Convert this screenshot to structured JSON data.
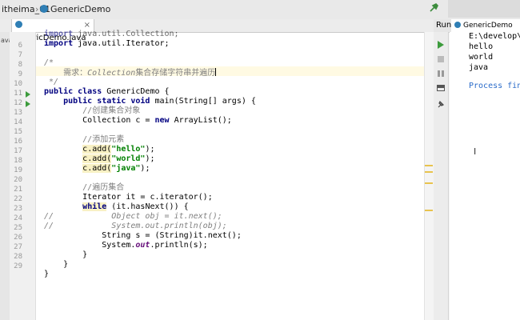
{
  "breadcrumb": {
    "project": "itheima_01",
    "file": "GenericDemo"
  },
  "editor_tab": {
    "label": "GenericDemo.java",
    "close": "×"
  },
  "left_strip": {
    "label": "ava"
  },
  "run_panel": {
    "run_label": "Run:",
    "tab_label": "GenericDemo",
    "console": [
      "E:\\develop\\",
      "hello",
      "world",
      "java",
      "",
      "Process fin"
    ]
  },
  "line_numbers": [
    "",
    "6",
    "7",
    "8",
    "9",
    "10",
    "11",
    "12",
    "13",
    "14",
    "15",
    "16",
    "17",
    "18",
    "19",
    "20",
    "21",
    "22",
    "23",
    "24",
    "25",
    "26",
    "27",
    "28",
    "29"
  ],
  "code": {
    "l5a": "import java.util.Collection;",
    "l6a": "import",
    "l6b": " java.util.Iterator;",
    "l8a": "/*",
    "l9a": "    需求：",
    "l9b": "Collection",
    "l9c": "集合存储字符串并遍历",
    "l10a": " */",
    "l11a": "public class",
    "l11b": " GenericDemo {",
    "l12a": "    public static void",
    "l12b": " main(String[] args) {",
    "l13a": "        //创建集合对象",
    "l14a": "        Collection c = ",
    "l14b": "new",
    "l14c": " ArrayList();",
    "l16a": "        //添加元素",
    "l17a": "c.add(",
    "l17b": "\"hello\"",
    "l17c": ");",
    "l18a": "c.add(",
    "l18b": "\"world\"",
    "l18c": ");",
    "l19a": "c.add(",
    "l19b": "\"java\"",
    "l19c": ");",
    "l21a": "        //遍历集合",
    "l22a": "        Iterator it = c.iterator();",
    "l23a": "while",
    "l23b": " (it.hasNext()) {",
    "l24a": "//",
    "l24b": "            Object obj = it.next();",
    "l25a": "//",
    "l25b": "            System.out.println(obj);",
    "l26a": "            String s = (String)it.next();",
    "l27a": "            System.",
    "l27b": "out",
    "l27c": ".println(s);",
    "l28a": "        }",
    "l29a": "    }",
    "l30a": "}"
  }
}
